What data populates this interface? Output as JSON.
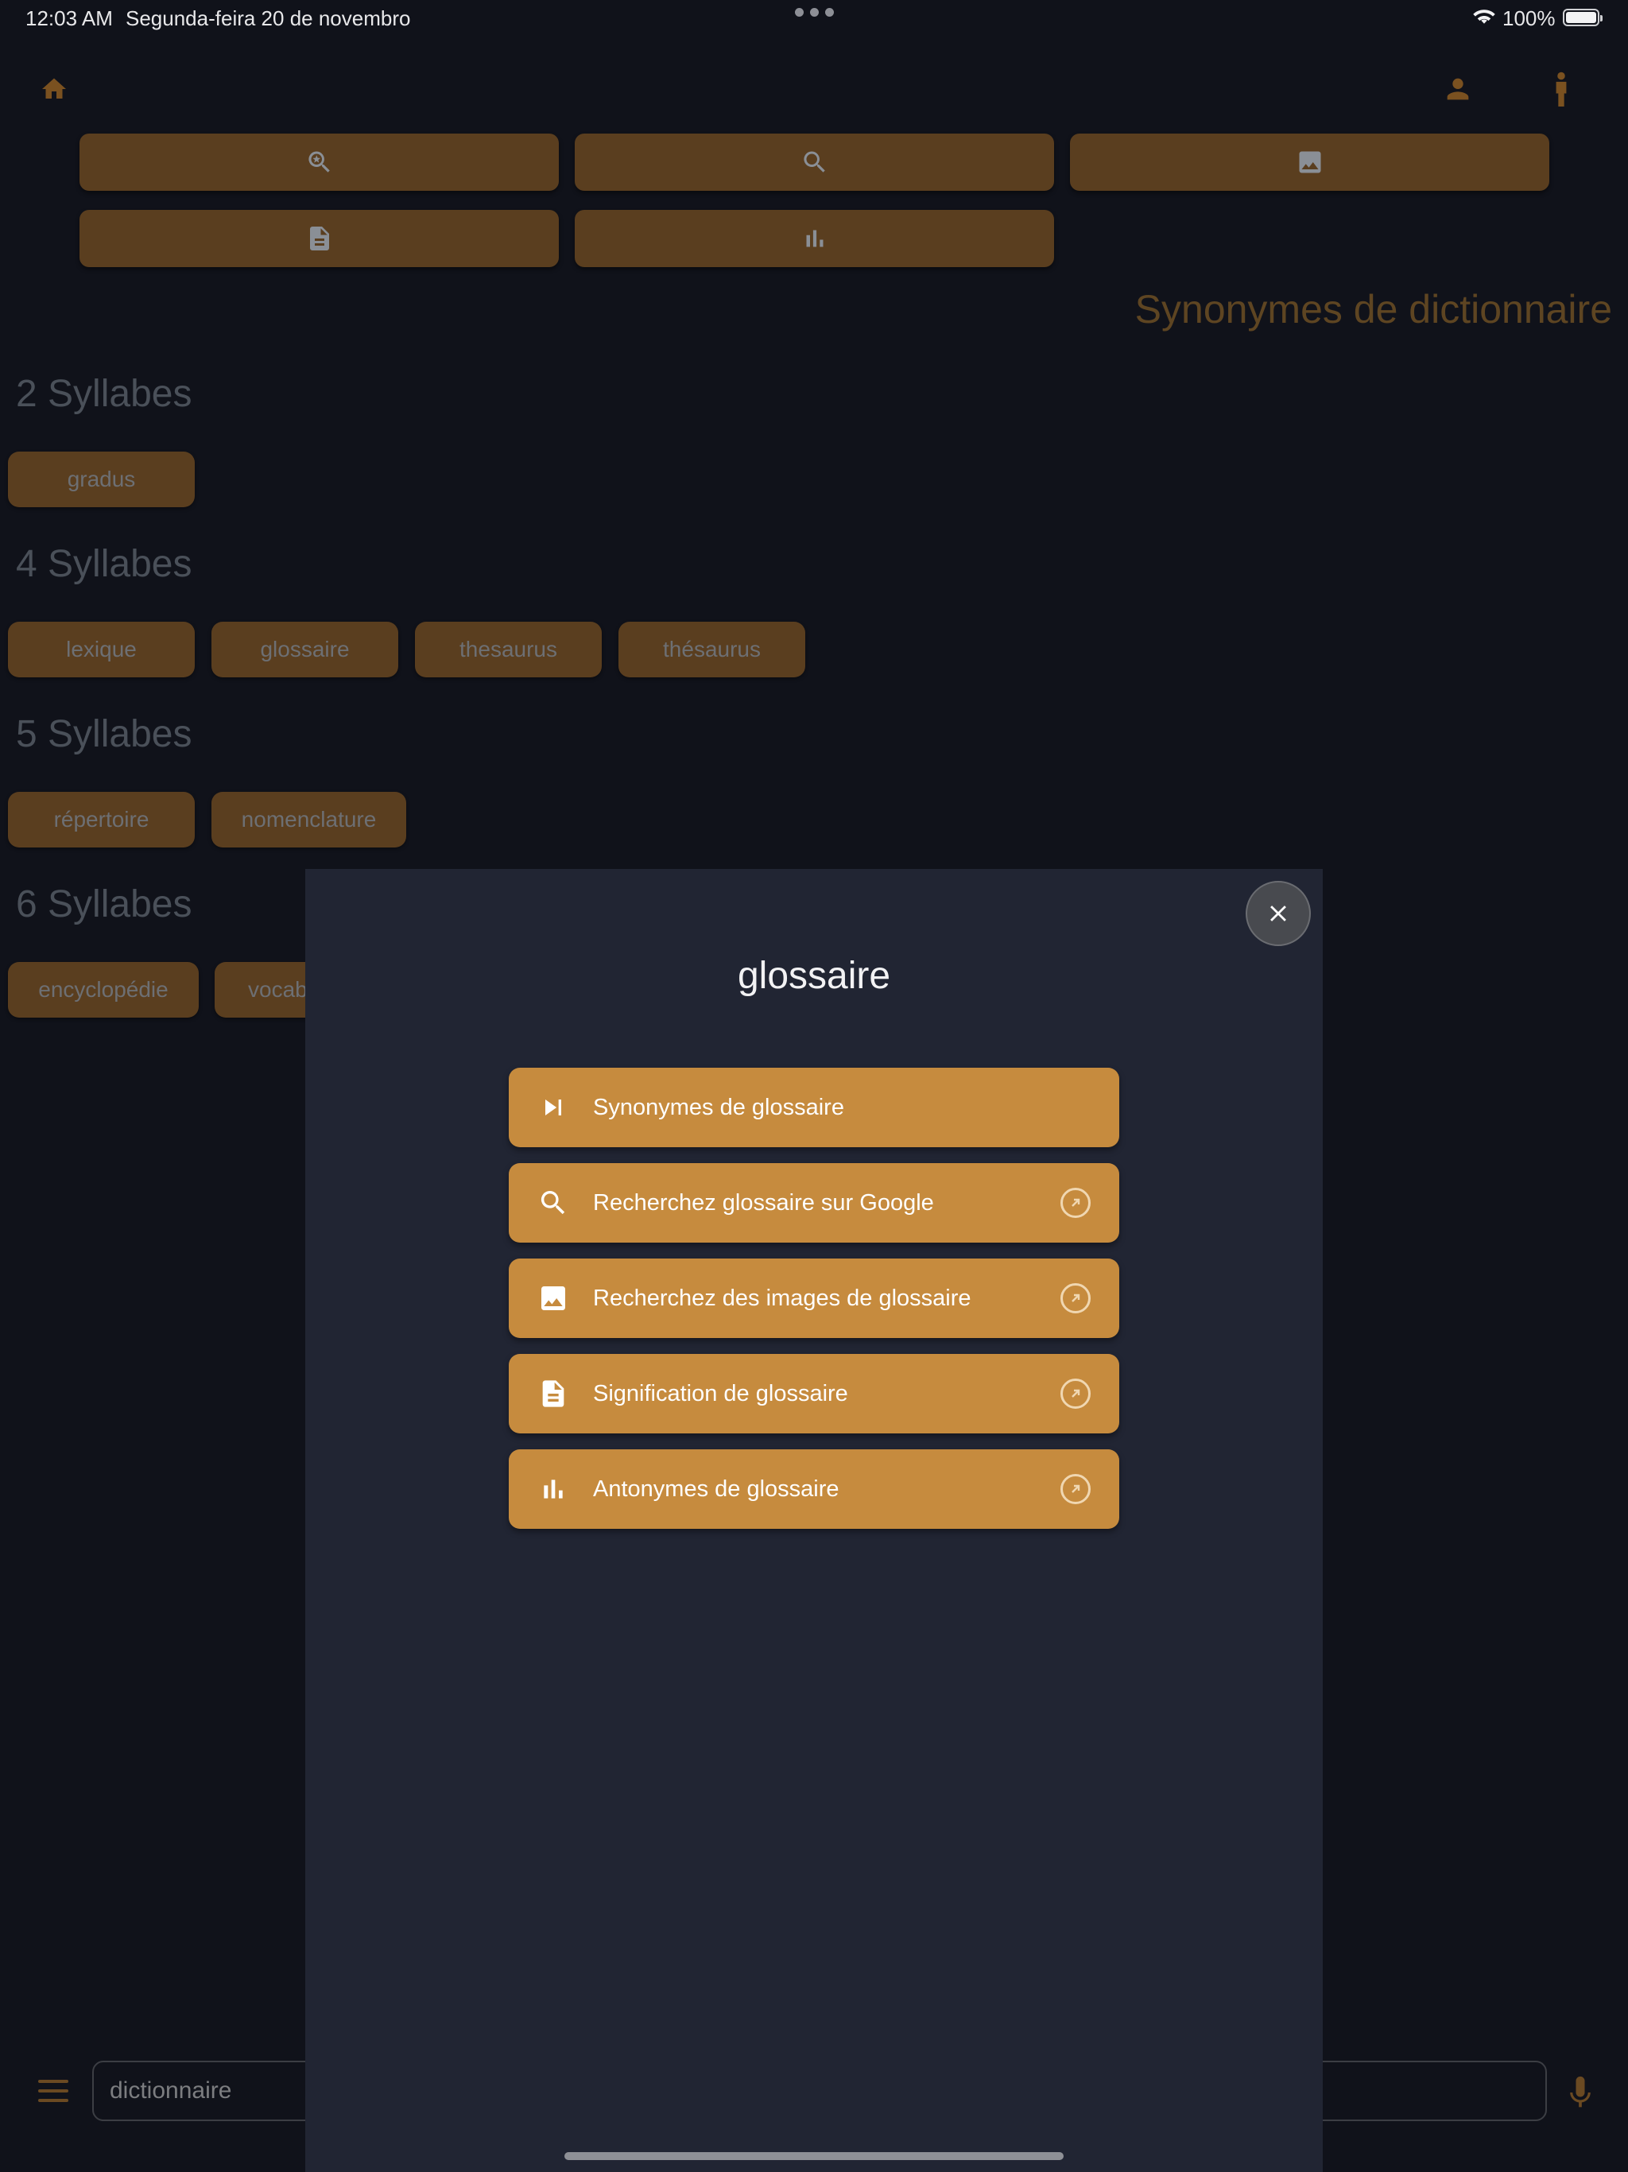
{
  "status_bar": {
    "time": "12:03 AM",
    "date": "Segunda-feira 20 de novembro",
    "battery": "100%"
  },
  "header": {
    "title": "Synonymes de dictionnaire"
  },
  "toolbar": {
    "buttons": [
      "zoom-search-icon",
      "search-icon",
      "image-icon",
      "document-icon",
      "bar-chart-icon"
    ]
  },
  "sections": [
    {
      "heading": "2 Syllabes",
      "words": [
        "gradus"
      ]
    },
    {
      "heading": "4 Syllabes",
      "words": [
        "lexique",
        "glossaire",
        "thesaurus",
        "thésaurus"
      ]
    },
    {
      "heading": "5 Syllabes",
      "words": [
        "répertoire",
        "nomenclature"
      ]
    },
    {
      "heading": "6 Syllabes",
      "words": [
        "encyclopédie",
        "vocab"
      ]
    }
  ],
  "search": {
    "value": "dictionnaire"
  },
  "modal": {
    "title": "glossaire",
    "actions": [
      {
        "label": "Synonymes de glossaire",
        "icon": "skip-next-icon",
        "external": false
      },
      {
        "label": "Recherchez glossaire sur Google",
        "icon": "search-icon",
        "external": true
      },
      {
        "label": "Recherchez des images de glossaire",
        "icon": "image-icon",
        "external": true
      },
      {
        "label": "Signification de glossaire",
        "icon": "document-icon",
        "external": true
      },
      {
        "label": "Antonymes de glossaire",
        "icon": "bar-chart-icon",
        "external": true
      }
    ]
  },
  "colors": {
    "accent": "#c68b3e",
    "accent_dim": "#5a3e1f",
    "background": "#10121a",
    "modal_bg": "#212533"
  }
}
